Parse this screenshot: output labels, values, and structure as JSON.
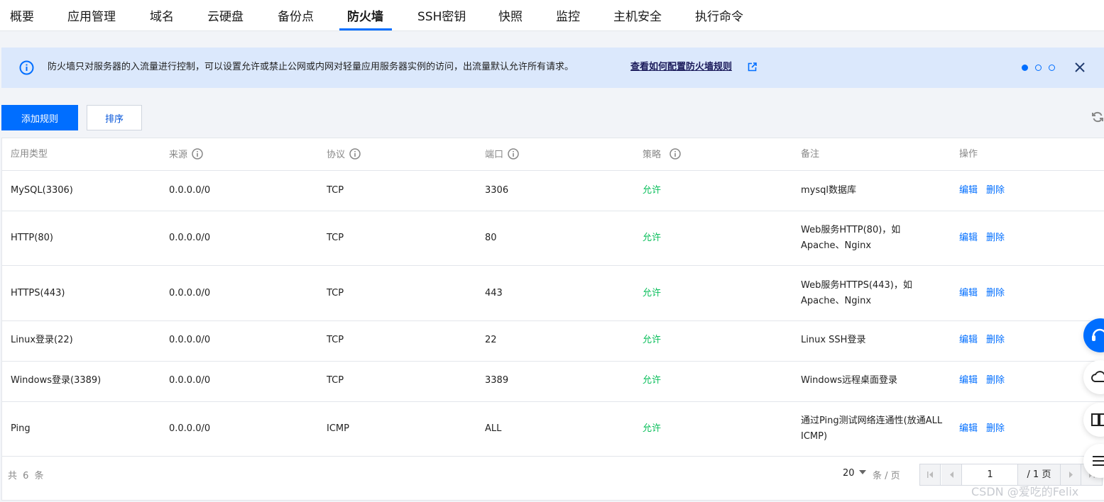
{
  "tabs": [
    "概要",
    "应用管理",
    "域名",
    "云硬盘",
    "备份点",
    "防火墙",
    "SSH密钥",
    "快照",
    "监控",
    "主机安全",
    "执行命令"
  ],
  "active_tab": "防火墙",
  "notice": {
    "text": "防火墙只对服务器的入流量进行控制，可以设置允许或禁止公网或内网对轻量应用服务器实例的访问，出流量默认允许所有请求。",
    "link": "查看如何配置防火墙规则",
    "carousel_active_index": 0,
    "carousel_count": 3
  },
  "toolbar": {
    "add_rule": "添加规则",
    "sort": "排序"
  },
  "table": {
    "columns": [
      "应用类型",
      "来源",
      "协议",
      "端口",
      "策略",
      "备注",
      "操作"
    ],
    "rows": [
      {
        "app": "MySQL(3306)",
        "source": "0.0.0.0/0",
        "protocol": "TCP",
        "port": "3306",
        "policy": "允许",
        "note": "mysql数据库"
      },
      {
        "app": "HTTP(80)",
        "source": "0.0.0.0/0",
        "protocol": "TCP",
        "port": "80",
        "policy": "允许",
        "note": "Web服务HTTP(80)，如Apache、Nginx"
      },
      {
        "app": "HTTPS(443)",
        "source": "0.0.0.0/0",
        "protocol": "TCP",
        "port": "443",
        "policy": "允许",
        "note": "Web服务HTTPS(443)，如Apache、Nginx"
      },
      {
        "app": "Linux登录(22)",
        "source": "0.0.0.0/0",
        "protocol": "TCP",
        "port": "22",
        "policy": "允许",
        "note": "Linux SSH登录"
      },
      {
        "app": "Windows登录(3389)",
        "source": "0.0.0.0/0",
        "protocol": "TCP",
        "port": "3389",
        "policy": "允许",
        "note": "Windows远程桌面登录"
      },
      {
        "app": "Ping",
        "source": "0.0.0.0/0",
        "protocol": "ICMP",
        "port": "ALL",
        "policy": "允许",
        "note": "通过Ping测试网络连通性(放通ALL ICMP)"
      }
    ],
    "actions": {
      "edit": "编辑",
      "delete": "删除"
    }
  },
  "footer": {
    "total": "共 6 条",
    "page_size": "20",
    "page_size_unit": "条 / 页",
    "current_page": "1",
    "total_pages": "/ 1 页"
  },
  "watermark": "CSDN @爱吃的Felix",
  "colors": {
    "accent": "#006eff",
    "allow": "#0abf5b",
    "notice_bg": "#dbe8fc"
  }
}
